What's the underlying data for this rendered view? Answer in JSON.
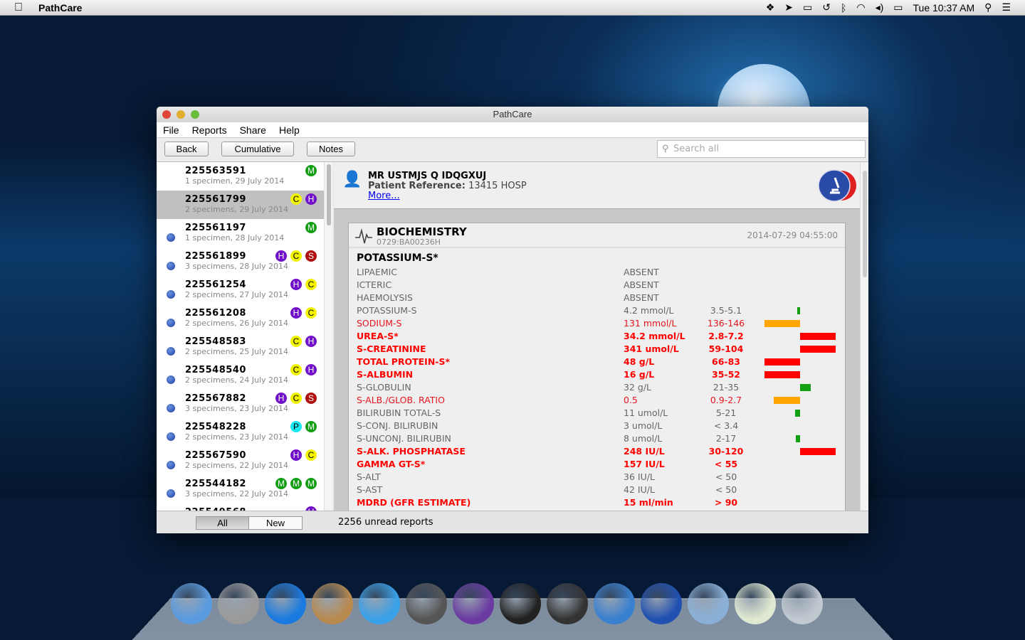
{
  "menubar": {
    "app": "PathCare",
    "clock": "Tue 10:37 AM",
    "icons": [
      "dropbox-icon",
      "navigation-icon",
      "airplay-icon",
      "time-machine-icon",
      "bluetooth-icon",
      "wifi-icon",
      "volume-icon",
      "battery-icon",
      "spotlight-icon",
      "notification-center-icon"
    ]
  },
  "window": {
    "title": "PathCare",
    "menu": [
      "File",
      "Reports",
      "Share",
      "Help"
    ],
    "toolbar": {
      "back": "Back",
      "cumulative": "Cumulative",
      "notes": "Notes",
      "search_placeholder": "Search all"
    }
  },
  "badge_colors": {
    "M": "#14a014",
    "C": "#f4f400",
    "H": "#7010c8",
    "S": "#b01010",
    "P": "#18e8f0"
  },
  "reports": [
    {
      "id": "225563591",
      "sub": "1 specimen, 29 July 2014",
      "badges": [
        "M"
      ],
      "unread": false
    },
    {
      "id": "225561799",
      "sub": "2 specimens, 29 July 2014",
      "badges": [
        "C",
        "H"
      ],
      "unread": false,
      "selected": true
    },
    {
      "id": "225561197",
      "sub": "1 specimen, 28 July 2014",
      "badges": [
        "M"
      ],
      "unread": true
    },
    {
      "id": "225561899",
      "sub": "3 specimens, 28 July 2014",
      "badges": [
        "H",
        "C",
        "S"
      ],
      "unread": true
    },
    {
      "id": "225561254",
      "sub": "2 specimens, 27 July 2014",
      "badges": [
        "H",
        "C"
      ],
      "unread": true
    },
    {
      "id": "225561208",
      "sub": "2 specimens, 26 July 2014",
      "badges": [
        "H",
        "C"
      ],
      "unread": true
    },
    {
      "id": "225548583",
      "sub": "2 specimens, 25 July 2014",
      "badges": [
        "C",
        "H"
      ],
      "unread": true
    },
    {
      "id": "225548540",
      "sub": "2 specimens, 24 July 2014",
      "badges": [
        "C",
        "H"
      ],
      "unread": true
    },
    {
      "id": "225567882",
      "sub": "3 specimens, 23 July 2014",
      "badges": [
        "H",
        "C",
        "S"
      ],
      "unread": true
    },
    {
      "id": "225548228",
      "sub": "2 specimens, 23 July 2014",
      "badges": [
        "P",
        "M"
      ],
      "unread": true
    },
    {
      "id": "225567590",
      "sub": "2 specimens, 22 July 2014",
      "badges": [
        "H",
        "C"
      ],
      "unread": true
    },
    {
      "id": "225544182",
      "sub": "3 specimens, 22 July 2014",
      "badges": [
        "M",
        "M",
        "M"
      ],
      "unread": true
    },
    {
      "id": "225549568",
      "sub": "",
      "badges": [
        "H"
      ],
      "unread": true
    }
  ],
  "patient": {
    "name": "MR  USTMJS Q  IDQGXUJ",
    "ref_label": "Patient Reference:",
    "ref_value": "13415 HOSP",
    "more": "More..."
  },
  "report": {
    "title": "BIOCHEMISTRY",
    "code": "0729:BA00236H",
    "datetime": "2014-07-29  04:55:00",
    "section": "POTASSIUM-S*",
    "rows": [
      {
        "name": "LIPAEMIC",
        "value": "ABSENT",
        "range": "",
        "flag": "normal"
      },
      {
        "name": "ICTERIC",
        "value": "ABSENT",
        "range": "",
        "flag": "normal"
      },
      {
        "name": "HAEMOLYSIS",
        "value": "ABSENT",
        "range": "",
        "flag": "normal"
      },
      {
        "name": "POTASSIUM-S",
        "value": "4.2 mmol/L",
        "range": "3.5-5.1",
        "flag": "normal",
        "bar": {
          "dir": "left",
          "level": 0.08,
          "color": "#10a010"
        }
      },
      {
        "name": "SODIUM-S",
        "value": "131 mmol/L",
        "range": "136-146",
        "flag": "abnormal",
        "bar": {
          "dir": "left",
          "level": 1.0,
          "color": "#ffa500"
        }
      },
      {
        "name": "UREA-S*",
        "value": "34.2 mmol/L",
        "range": "2.8-7.2",
        "flag": "critical",
        "bar": {
          "dir": "right",
          "level": 1.0,
          "color": "#ff0000"
        }
      },
      {
        "name": "S-CREATININE",
        "value": "341 umol/L",
        "range": "59-104",
        "flag": "critical",
        "bar": {
          "dir": "right",
          "level": 1.0,
          "color": "#ff0000"
        }
      },
      {
        "name": "TOTAL PROTEIN-S*",
        "value": "48 g/L",
        "range": "66-83",
        "flag": "critical",
        "bar": {
          "dir": "left",
          "level": 1.0,
          "color": "#ff0000"
        }
      },
      {
        "name": "S-ALBUMIN",
        "value": "16 g/L",
        "range": "35-52",
        "flag": "critical",
        "bar": {
          "dir": "left",
          "level": 1.0,
          "color": "#ff0000"
        }
      },
      {
        "name": "S-GLOBULIN",
        "value": "32 g/L",
        "range": "21-35",
        "flag": "normal",
        "bar": {
          "dir": "right",
          "level": 0.3,
          "color": "#10a010"
        }
      },
      {
        "name": "S-ALB./GLOB. RATIO",
        "value": "0.5",
        "range": "0.9-2.7",
        "flag": "abnormal",
        "bar": {
          "dir": "left",
          "level": 0.74,
          "color": "#ffa500"
        }
      },
      {
        "name": "BILIRUBIN TOTAL-S",
        "value": "11 umol/L",
        "range": "5-21",
        "flag": "normal",
        "bar": {
          "dir": "left",
          "level": 0.14,
          "color": "#10a010"
        }
      },
      {
        "name": "S-CONJ. BILIRUBIN",
        "value": "3 umol/L",
        "range": "< 3.4",
        "flag": "normal"
      },
      {
        "name": "S-UNCONJ. BILIRUBIN",
        "value": "8 umol/L",
        "range": "2-17",
        "flag": "normal",
        "bar": {
          "dir": "left",
          "level": 0.12,
          "color": "#10a010"
        }
      },
      {
        "name": "S-ALK. PHOSPHATASE",
        "value": "248 IU/L",
        "range": "30-120",
        "flag": "critical",
        "bar": {
          "dir": "right",
          "level": 1.0,
          "color": "#ff0000"
        }
      },
      {
        "name": "GAMMA GT-S*",
        "value": "157 IU/L",
        "range": "< 55",
        "flag": "critical"
      },
      {
        "name": "S-ALT",
        "value": "36 IU/L",
        "range": "< 50",
        "flag": "normal"
      },
      {
        "name": "S-AST",
        "value": "42 IU/L",
        "range": "< 50",
        "flag": "normal"
      },
      {
        "name": "MDRD (GFR ESTIMATE)",
        "value": "15 ml/min",
        "range": "> 90",
        "flag": "critical"
      }
    ]
  },
  "bottom": {
    "all": "All",
    "new": "New",
    "status": "2256 unread reports"
  },
  "dock": [
    {
      "name": "finder",
      "color": "#5a9be0"
    },
    {
      "name": "launchpad",
      "color": "#9a9a9a"
    },
    {
      "name": "app-store",
      "color": "#1a7ae0"
    },
    {
      "name": "mail",
      "color": "#b88a50"
    },
    {
      "name": "safari",
      "color": "#3aa0e8"
    },
    {
      "name": "disk-utility",
      "color": "#555"
    },
    {
      "name": "eclipse",
      "color": "#6a3aa0"
    },
    {
      "name": "terminal",
      "color": "#222"
    },
    {
      "name": "activity-monitor",
      "color": "#333"
    },
    {
      "name": "xcode",
      "color": "#3a80d0"
    },
    {
      "name": "pathcare",
      "color": "#2050b0"
    },
    {
      "name": "applications-folder",
      "color": "#8ab0d8"
    },
    {
      "name": "certificate",
      "color": "#dfe8d0"
    },
    {
      "name": "trash",
      "color": "#c0c8d0"
    }
  ]
}
